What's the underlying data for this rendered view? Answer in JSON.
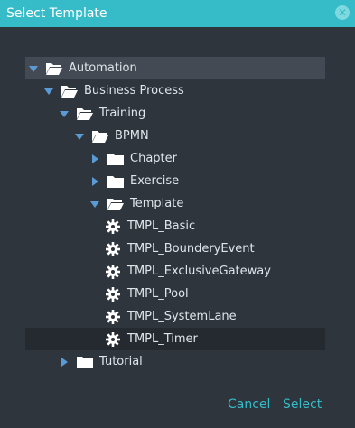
{
  "dialog": {
    "title": "Select Template",
    "close_icon": "close-circle-icon"
  },
  "tree": [
    {
      "label": "Automation",
      "level": 0,
      "state": "expanded",
      "icon": "folder-open-icon",
      "highlight": true
    },
    {
      "label": "Business Process",
      "level": 1,
      "state": "expanded",
      "icon": "folder-open-icon"
    },
    {
      "label": "Training",
      "level": 2,
      "state": "expanded",
      "icon": "folder-open-icon"
    },
    {
      "label": "BPMN",
      "level": 3,
      "state": "expanded",
      "icon": "folder-open-icon"
    },
    {
      "label": "Chapter",
      "level": 4,
      "state": "collapsed",
      "icon": "folder-icon"
    },
    {
      "label": "Exercise",
      "level": 4,
      "state": "collapsed",
      "icon": "folder-icon"
    },
    {
      "label": "Template",
      "level": 4,
      "state": "expanded",
      "icon": "folder-open-icon"
    },
    {
      "label": "TMPL_Basic",
      "level": 5,
      "state": "leaf",
      "icon": "gear-icon"
    },
    {
      "label": "TMPL_BounderyEvent",
      "level": 5,
      "state": "leaf",
      "icon": "gear-icon"
    },
    {
      "label": "TMPL_ExclusiveGateway",
      "level": 5,
      "state": "leaf",
      "icon": "gear-icon"
    },
    {
      "label": "TMPL_Pool",
      "level": 5,
      "state": "leaf",
      "icon": "gear-icon"
    },
    {
      "label": "TMPL_SystemLane",
      "level": 5,
      "state": "leaf",
      "icon": "gear-icon"
    },
    {
      "label": "TMPL_Timer",
      "level": 5,
      "state": "leaf",
      "icon": "gear-icon",
      "selected": true
    },
    {
      "label": "Tutorial",
      "level": 2,
      "state": "collapsed",
      "icon": "folder-icon"
    }
  ],
  "footer": {
    "cancel_label": "Cancel",
    "select_label": "Select"
  },
  "colors": {
    "accent": "#35bcc8",
    "background": "#2e353d",
    "row_highlight": "#434a53",
    "row_selected": "#252a30",
    "arrow": "#5b9bd5",
    "text": "#dfe5ea"
  }
}
